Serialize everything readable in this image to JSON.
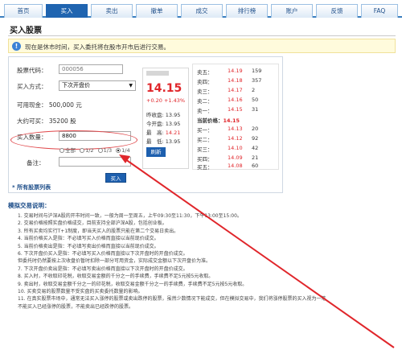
{
  "tabs": [
    {
      "label": "首页"
    },
    {
      "label": "买入"
    },
    {
      "label": "卖出"
    },
    {
      "label": "撤单"
    },
    {
      "label": "成交"
    },
    {
      "label": "排行榜"
    },
    {
      "label": "账户"
    },
    {
      "label": "反馈"
    },
    {
      "label": "FAQ"
    }
  ],
  "active_tab": "买入",
  "page_title": "买入股票",
  "notice": "现在是休市时间，买入委托将在股市开市后进行交易。",
  "form": {
    "code_label": "股票代码：",
    "code_value": "000056",
    "method_label": "买入方式：",
    "method_value": "下次开盘价",
    "cash_label": "可用现金：",
    "cash_value": "500,000 元",
    "approx_label": "大约可买：",
    "approx_value": "35200 股",
    "qty_label": "买入数量：",
    "qty_value": "8800",
    "radios": [
      "全部",
      "1/2",
      "1/3",
      "1/4"
    ],
    "selected_radio": "1/4",
    "note_label": "备注：",
    "note_value": "",
    "buy_button": "买入",
    "all_stocks_link": "* 所有股票列表"
  },
  "quote": {
    "price": "14.15",
    "change": "+0.20  +1.43%",
    "prev_close_label": "昨收盘:",
    "prev_close": "13.95",
    "open_label": "今开盘:",
    "open": "13.95",
    "high_label": "最　高:",
    "high": "14.21",
    "low_label": "最　低:",
    "low": "13.95",
    "refresh_button": "刷新"
  },
  "orderbook": {
    "sells": [
      {
        "label": "卖五：",
        "price": "14.19",
        "vol": "159"
      },
      {
        "label": "卖四：",
        "price": "14.18",
        "vol": "357"
      },
      {
        "label": "卖三：",
        "price": "14.17",
        "vol": "2"
      },
      {
        "label": "卖二：",
        "price": "14.16",
        "vol": "50"
      },
      {
        "label": "卖一：",
        "price": "14.15",
        "vol": "31"
      }
    ],
    "current_label": "当前价格：",
    "current_price": "14.15",
    "buys": [
      {
        "label": "买一：",
        "price": "14.13",
        "vol": "20"
      },
      {
        "label": "买二：",
        "price": "14.12",
        "vol": "92"
      },
      {
        "label": "买三：",
        "price": "14.10",
        "vol": "42"
      },
      {
        "label": "买四：",
        "price": "14.09",
        "vol": "21"
      },
      {
        "label": "买五：",
        "price": "14.08",
        "vol": "60"
      }
    ]
  },
  "rules_title": "模拟交易说明：",
  "rules": [
    "1.  交易时间与沪深A股的开市时间一致，一般为周一至周五，上午09:30至11:30，下午13:00至15:00。",
    "2.  交易价格按照实盘价格成交，目前支持全部沪深A股，包括创业板。",
    "3.  所有买卖均实行T+1制度，即当天买入的股票只能在第二个交易日卖出。",
    "4.  当前价格买入是指：不必填写买入价格而直接以当前现价成交。",
    "5.  当前价格卖出是指：不必填写卖出价格而直接以当前现价成交。",
    "6.  下次开盘价买入是指：不必填写买入价格而直接以下次开盘时的开盘价成交。",
    "     但委托时仍然要按上次收盘价暂时扣除一部分可用资金，实际成交金额以下次开盘价为准。",
    "7.  下次开盘价卖出是指：不必填写卖出价格而直接以下次开盘时的开盘价成交。",
    "8.  买入时，不收取印花税，收取交易金额的千分之一的手续费，手续费不足5元按5元收取。",
    "9.  卖出时，收取交易金额千分之一的印花税，收取交易金额千分之一的手续费，手续费不足5元按5元收取。",
    "10. 买卖交易的股票数量不受实盘的买卖委托数量的影响。",
    "11. 在真实股票市场中，通常无法买入涨停的股票或卖出跌停的股票，虽然少数情况下能成交，但在模拟交易中，我们将涨停股票的买入视为一笔",
    "     不能买入已经涨停的股票，不能卖出已经跌停的股票。"
  ]
}
